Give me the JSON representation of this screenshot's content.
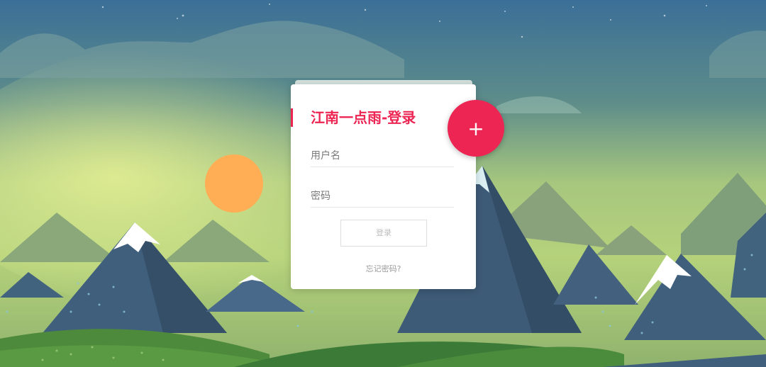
{
  "login": {
    "title": "江南一点雨-登录",
    "username_placeholder": "用户名",
    "password_placeholder": "密码",
    "submit_label": "登录",
    "forgot_label": "忘记密码?",
    "fab_label": "+"
  },
  "icons": {
    "fab": "plus-icon"
  },
  "colors": {
    "accent": "#ed2553",
    "sun": "#ffae55",
    "sky_top": "#3a6d95",
    "sky_glow": "#c8df82"
  }
}
